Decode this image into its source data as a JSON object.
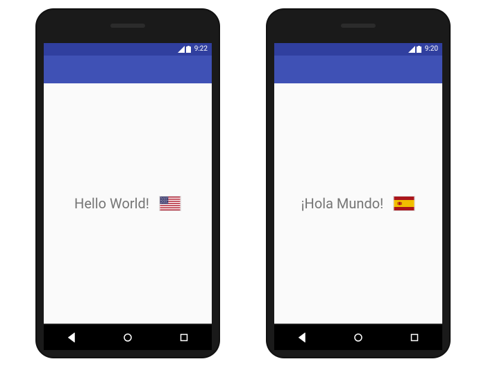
{
  "phones": [
    {
      "status": {
        "time": "9:22"
      },
      "content": {
        "greeting": "Hello World!",
        "flag": "us"
      },
      "flag_colors": {
        "bg": "#b22234",
        "field": "#3c3b6e"
      }
    },
    {
      "status": {
        "time": "9:20"
      },
      "content": {
        "greeting": "¡Hola Mundo!",
        "flag": "es"
      },
      "flag_colors": {
        "red": "#aa151b",
        "yellow": "#f1bf00"
      }
    }
  ],
  "colors": {
    "primary": "#3f51b5",
    "primary_dark": "#303f9f",
    "text_secondary": "#757575"
  }
}
